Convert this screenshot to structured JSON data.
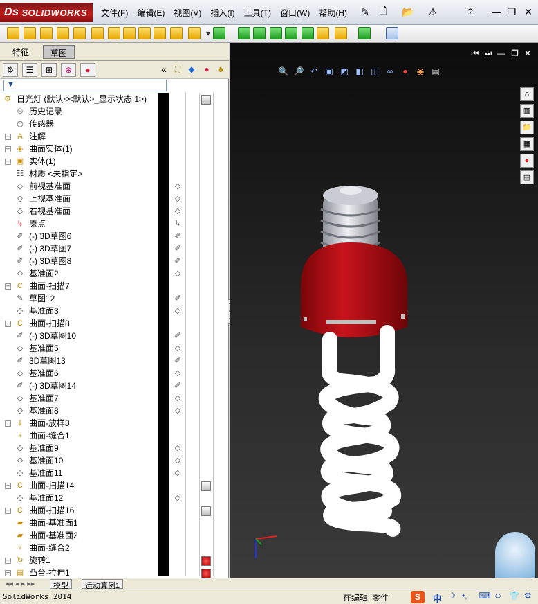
{
  "app": {
    "brand": "SOLIDWORKS",
    "menus": [
      "文件(F)",
      "编辑(E)",
      "视图(V)",
      "插入(I)",
      "工具(T)",
      "窗口(W)",
      "帮助(H)"
    ]
  },
  "left_tabs": [
    "特征",
    "草图"
  ],
  "panel_collapse_glyph": "«",
  "tree_root": "日光灯  (默认<<默认>_显示状态 1>)",
  "tree": [
    {
      "label": "历史记录",
      "icon": "history-icon",
      "expandable": false
    },
    {
      "label": "传感器",
      "icon": "sensor-icon",
      "expandable": false
    },
    {
      "label": "注解",
      "icon": "annotation-icon",
      "expandable": true
    },
    {
      "label": "曲面实体(1)",
      "icon": "surface-body-icon",
      "expandable": true
    },
    {
      "label": "实体(1)",
      "icon": "solid-body-icon",
      "expandable": true
    },
    {
      "label": "材质 <未指定>",
      "icon": "material-icon",
      "expandable": false
    },
    {
      "label": "前视基准面",
      "icon": "plane-icon",
      "expandable": false
    },
    {
      "label": "上视基准面",
      "icon": "plane-icon",
      "expandable": false
    },
    {
      "label": "右视基准面",
      "icon": "plane-icon",
      "expandable": false
    },
    {
      "label": "原点",
      "icon": "origin-icon",
      "expandable": false
    },
    {
      "label": "(-) 3D草图6",
      "icon": "sketch3d-icon",
      "expandable": false
    },
    {
      "label": "(-) 3D草图7",
      "icon": "sketch3d-icon",
      "expandable": false
    },
    {
      "label": "(-) 3D草图8",
      "icon": "sketch3d-icon",
      "expandable": false
    },
    {
      "label": "基准面2",
      "icon": "plane-icon",
      "expandable": false
    },
    {
      "label": "曲面-扫描7",
      "icon": "sweep-icon",
      "expandable": true
    },
    {
      "label": "草图12",
      "icon": "sketch-icon",
      "expandable": false
    },
    {
      "label": "基准面3",
      "icon": "plane-icon",
      "expandable": false
    },
    {
      "label": "曲面-扫描8",
      "icon": "sweep-icon",
      "expandable": true
    },
    {
      "label": "(-) 3D草图10",
      "icon": "sketch3d-icon",
      "expandable": false
    },
    {
      "label": "基准面5",
      "icon": "plane-icon",
      "expandable": false
    },
    {
      "label": "3D草图13",
      "icon": "sketch3d-icon",
      "expandable": false
    },
    {
      "label": "基准面6",
      "icon": "plane-icon",
      "expandable": false
    },
    {
      "label": "(-) 3D草图14",
      "icon": "sketch3d-icon",
      "expandable": false
    },
    {
      "label": "基准面7",
      "icon": "plane-icon",
      "expandable": false
    },
    {
      "label": "基准面8",
      "icon": "plane-icon",
      "expandable": false
    },
    {
      "label": "曲面-放样8",
      "icon": "loft-icon",
      "expandable": true
    },
    {
      "label": "曲面-缝合1",
      "icon": "knit-icon",
      "expandable": false
    },
    {
      "label": "基准面9",
      "icon": "plane-icon",
      "expandable": false
    },
    {
      "label": "基准面10",
      "icon": "plane-icon",
      "expandable": false
    },
    {
      "label": "基准面11",
      "icon": "plane-icon",
      "expandable": false
    },
    {
      "label": "曲面-扫描14",
      "icon": "sweep-icon",
      "expandable": true
    },
    {
      "label": "基准面12",
      "icon": "plane-icon",
      "expandable": false
    },
    {
      "label": "曲面-扫描16",
      "icon": "sweep-icon",
      "expandable": true
    },
    {
      "label": "曲面-基准面1",
      "icon": "planar-surface-icon",
      "expandable": false
    },
    {
      "label": "曲面-基准面2",
      "icon": "planar-surface-icon",
      "expandable": false
    },
    {
      "label": "曲面-缝合2",
      "icon": "knit-icon",
      "expandable": false
    },
    {
      "label": "旋转1",
      "icon": "revolve-icon",
      "expandable": true
    },
    {
      "label": "凸台-拉伸1",
      "icon": "extrude-icon",
      "expandable": true
    }
  ],
  "bottom_tabs": [
    "模型",
    "运动算例1"
  ],
  "status": {
    "app_version": "SolidWorks 2014",
    "editing": "在编辑",
    "mode": "零件",
    "ime_label": "中"
  },
  "colors": {
    "bulb_base": "#b8bcc4",
    "bulb_cap": "#b3121a",
    "bulb_tube": "#ffffff",
    "viewport_bg": "#1e1e1e"
  }
}
